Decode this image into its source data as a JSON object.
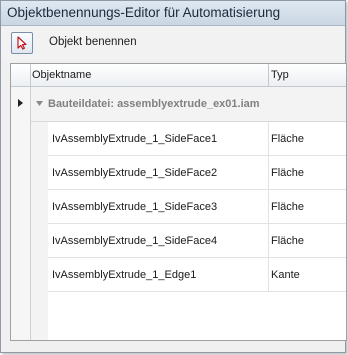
{
  "window": {
    "title": "Objektbenennungs-Editor für Automatisierung"
  },
  "toolbar": {
    "select_tool_icon": "cursor-arrow-icon",
    "rename_label": "Objekt benennen"
  },
  "grid": {
    "columns": [
      "Objektname",
      "Typ"
    ],
    "group": {
      "label": "Bauteildatei: assemblyextrude_ex01.iam",
      "expanded": true
    },
    "rows": [
      {
        "name": "IvAssemblyExtrude_1_SideFace1",
        "type": "Fläche"
      },
      {
        "name": "IvAssemblyExtrude_1_SideFace2",
        "type": "Fläche"
      },
      {
        "name": "IvAssemblyExtrude_1_SideFace3",
        "type": "Fläche"
      },
      {
        "name": "IvAssemblyExtrude_1_SideFace4",
        "type": "Fläche"
      },
      {
        "name": "IvAssemblyExtrude_1_Edge1",
        "type": "Kante"
      }
    ]
  },
  "colors": {
    "title_bg": "#cad6e3",
    "group_text": "#808080",
    "border": "#a0a0a0"
  }
}
